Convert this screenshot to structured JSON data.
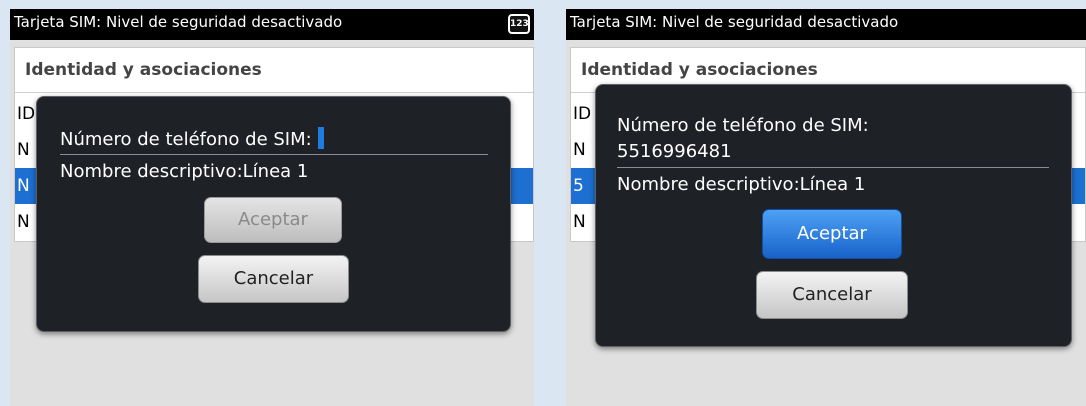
{
  "screens": [
    {
      "title": "Tarjeta SIM: Nivel de seguridad desactivado",
      "input_mode_badge": "123",
      "section_header": "Identidad y asociaciones",
      "rows": [
        "ID",
        "N",
        "N",
        "N"
      ],
      "dialog": {
        "phone_label": "Número de teléfono de SIM:",
        "phone_value": "",
        "name_label": "Nombre descriptivo:Línea 1",
        "accept_label": "Aceptar",
        "cancel_label": "Cancelar"
      }
    },
    {
      "title": "Tarjeta SIM: Nivel de seguridad desactivado",
      "section_header": "Identidad y asociaciones",
      "rows": [
        "ID",
        "N",
        "5",
        "N"
      ],
      "dialog": {
        "phone_label": "Número de teléfono de SIM:",
        "phone_value": "5516996481",
        "name_label": "Nombre descriptivo:Línea 1",
        "accept_label": "Aceptar",
        "cancel_label": "Cancelar"
      }
    }
  ],
  "colors": {
    "background": "#dbe6f3",
    "titlebar": "#000000",
    "selection": "#1d6fd1",
    "dialog": "#1e2126",
    "accent_button": "#1763c9",
    "cursor": "#1e7be0"
  },
  "icons": {
    "input_mode": "numeric-input-mode-icon"
  }
}
